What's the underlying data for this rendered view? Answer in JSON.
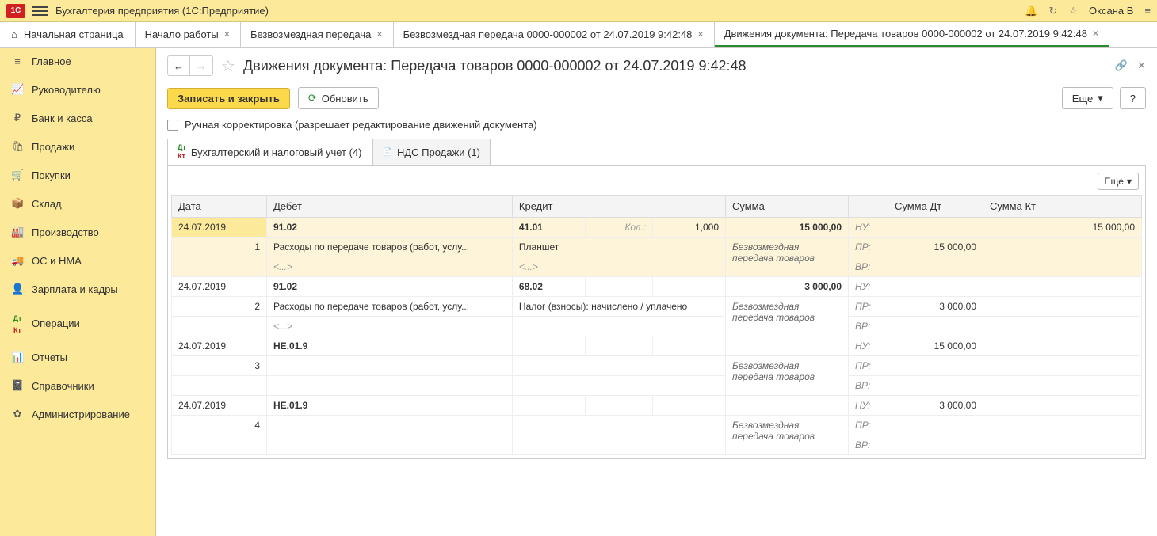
{
  "topbar": {
    "app_title": "Бухгалтерия предприятия   (1С:Предприятие)",
    "user": "Оксана В"
  },
  "tabs": {
    "home": "Начальная страница",
    "items": [
      {
        "label": "Начало работы"
      },
      {
        "label": "Безвозмездная передача"
      },
      {
        "label": "Безвозмездная передача 0000-000002 от 24.07.2019 9:42:48"
      },
      {
        "label": "Движения документа: Передача товаров 0000-000002 от 24.07.2019 9:42:48"
      }
    ]
  },
  "sidebar": {
    "items": [
      "Главное",
      "Руководителю",
      "Банк и касса",
      "Продажи",
      "Покупки",
      "Склад",
      "Производство",
      "ОС и НМА",
      "Зарплата и кадры",
      "Операции",
      "Отчеты",
      "Справочники",
      "Администрирование"
    ]
  },
  "page": {
    "title": "Движения документа: Передача товаров 0000-000002 от 24.07.2019 9:42:48",
    "save_close": "Записать и закрыть",
    "refresh": "Обновить",
    "more": "Еще",
    "help": "?",
    "manual_edit": "Ручная корректировка (разрешает редактирование движений документа)"
  },
  "subtabs": {
    "accounting": "Бухгалтерский и налоговый учет (4)",
    "vat": "НДС Продажи (1)"
  },
  "grid": {
    "headers": {
      "date": "Дата",
      "debit": "Дебет",
      "credit": "Кредит",
      "sum": "Сумма",
      "sum_dt": "Сумма Дт",
      "sum_kt": "Сумма Кт"
    },
    "qty_label": "Кол.:",
    "nu": "НУ:",
    "pr": "ПР:",
    "vr": "ВР:",
    "ellipsis": "<...>",
    "rows": [
      {
        "date": "24.07.2019",
        "n": "1",
        "debit_acc": "91.02",
        "debit_desc": "Расходы по передаче товаров (работ, услу...",
        "credit_acc": "41.01",
        "credit_desc": "Планшет",
        "qty": "1,000",
        "sum": "15 000,00",
        "sum_desc": "Безвозмездная передача товаров",
        "nu_kt": "15 000,00",
        "pr_dt": "15 000,00"
      },
      {
        "date": "24.07.2019",
        "n": "2",
        "debit_acc": "91.02",
        "debit_desc": "Расходы по передаче товаров (работ, услу...",
        "credit_acc": "68.02",
        "credit_desc": "Налог (взносы): начислено / уплачено",
        "sum": "3 000,00",
        "sum_desc": "Безвозмездная передача товаров",
        "pr_dt": "3 000,00"
      },
      {
        "date": "24.07.2019",
        "n": "3",
        "debit_acc": "НЕ.01.9",
        "sum_desc": "Безвозмездная передача товаров",
        "nu_dt": "15 000,00"
      },
      {
        "date": "24.07.2019",
        "n": "4",
        "debit_acc": "НЕ.01.9",
        "sum_desc": "Безвозмездная передача товаров",
        "nu_dt": "3 000,00"
      }
    ]
  }
}
